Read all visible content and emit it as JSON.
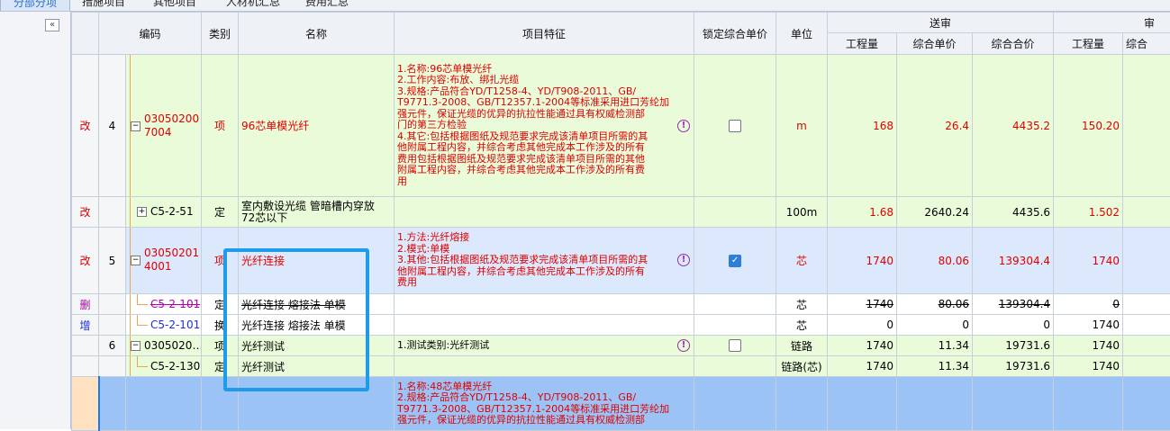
{
  "tabs": [
    "分部分项",
    "措施项目",
    "其他项目",
    "人材机汇总",
    "费用汇总"
  ],
  "sidebar": {
    "collapse_icon": "«"
  },
  "headers": {
    "code": "编码",
    "category": "类别",
    "name": "名称",
    "feature": "项目特征",
    "lock_price": "锁定综合单价",
    "unit": "单位",
    "group_sent": "送审",
    "group_next": "审",
    "qty": "工程量",
    "unit_price": "综合单价",
    "total_price": "综合合价",
    "qty2": "工程量",
    "unit_price2": "综合"
  },
  "rows": [
    {
      "mark": "改",
      "seq": "4",
      "code": "030502007004",
      "category": "项",
      "name": "96芯单模光纤",
      "feature_lines": [
        "1.名称:96芯单模光纤",
        "2.工作内容:布放、绑扎光缆",
        "3.规格:产品符合YD/T1258-4、YD/T908-2011、GB/",
        "T9771.3-2008、GB/T12357.1-2004等标准采用进口芳纶加",
        "强元件，保证光缆的优异的抗拉性能通过具有权威检测部",
        "门的第三方检验",
        "4.其它:包括根据图纸及规范要求完成该清单项目所需的其",
        "他附属工程内容，并综合考虑其他完成本工作涉及的所有",
        "费用包括根据图纸及规范要求完成该清单项目所需的其他",
        "附属工程内容，并综合考虑其他完成本工作涉及的所有费",
        "用"
      ],
      "unit": "m",
      "qty": "168",
      "unit_price": "26.4",
      "total": "4435.2",
      "qty2": "150.20"
    },
    {
      "mark": "改",
      "seq": "",
      "code": "C5-2-51",
      "category": "定",
      "name": "室内敷设光缆 管暗槽内穿放 72芯以下",
      "unit": "100m",
      "qty": "1.68",
      "unit_price": "2640.24",
      "total": "4435.6",
      "qty2": "1.502"
    },
    {
      "mark": "改",
      "seq": "5",
      "code": "030502014001",
      "category": "项",
      "name": "光纤连接",
      "feature_lines": [
        "1.方法:光纤熔接",
        "2.模式:单模",
        "3.其他:包括根据图纸及规范要求完成该清单项目所需的其",
        "他附属工程内容，并综合考虑其他完成本工作涉及的所有",
        "费用"
      ],
      "unit": "芯",
      "qty": "1740",
      "unit_price": "80.06",
      "total": "139304.4",
      "qty2": "1740"
    },
    {
      "mark": "删",
      "code": "C5-2-101",
      "category": "定",
      "name": "光纤连接 熔接法 单模",
      "unit": "芯",
      "qty": "1740",
      "unit_price": "80.06",
      "total": "139304.4",
      "qty2": "0"
    },
    {
      "mark": "增",
      "code": "C5-2-101",
      "category": "换",
      "name": "光纤连接 熔接法 单模",
      "unit": "芯",
      "qty": "0",
      "unit_price": "0",
      "total": "0",
      "qty2": "1740"
    },
    {
      "seq": "6",
      "code": "0305020…",
      "category": "项",
      "name": "光纤测试",
      "feature_lines": [
        "1.测试类别:光纤测试"
      ],
      "unit": "链路",
      "qty": "1740",
      "unit_price": "11.34",
      "total": "19731.6",
      "qty2": "1740"
    },
    {
      "code": "C5-2-130",
      "category": "定",
      "name": "光纤测试",
      "unit": "链路(芯)",
      "qty": "1740",
      "unit_price": "11.34",
      "total": "19731.6",
      "qty2": "1740"
    },
    {
      "feature_lines": [
        "1.名称:48芯单模光纤",
        "2.规格:产品符合YD/T1258-4、YD/T908-2011、GB/",
        "T9771.3-2008、GB/T12357.1-2004等标准采用进口芳纶加",
        "强元件，保证光缆的优异的抗拉性能通过具有权威检测部"
      ]
    }
  ],
  "icons": {
    "warning": "!",
    "checkmark": "✓",
    "expand": "+",
    "collapse": "−"
  },
  "colors": {
    "highlight_box": "#1e9be9",
    "changed_text": "#e00000"
  }
}
